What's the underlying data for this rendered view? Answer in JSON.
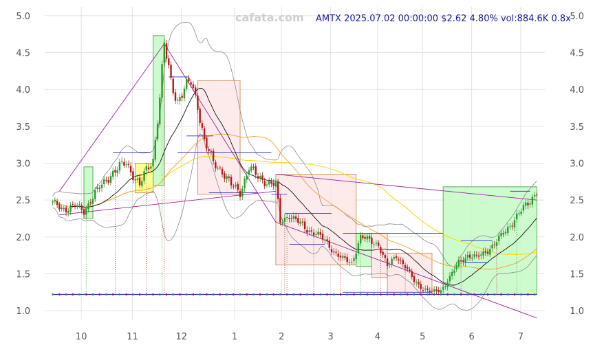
{
  "chart_data": {
    "type": "candlestick",
    "ticker": "AMTX",
    "header": "AMTX 2025.07.02 00:00:00 $2.62 4.80% vol:884.6K 0.8x",
    "watermark": "cafata.com",
    "x_tick_labels": [
      "10",
      "11",
      "12",
      "1",
      "2",
      "3",
      "4",
      "5",
      "6",
      "7"
    ],
    "y_ticks": [
      1.0,
      1.5,
      2.0,
      2.5,
      3.0,
      3.5,
      4.0,
      4.5,
      5.0
    ],
    "y_tick_labels": [
      "1.0",
      "1.5",
      "2.0",
      "2.5",
      "3.0",
      "3.5",
      "4.0",
      "4.5",
      "5.0"
    ],
    "ylim": [
      0.88,
      5.12
    ],
    "grid": true,
    "price_anchors": [
      [
        0,
        2.45
      ],
      [
        5,
        2.38
      ],
      [
        10,
        2.42
      ],
      [
        14,
        2.35
      ],
      [
        18,
        2.55
      ],
      [
        22,
        2.7
      ],
      [
        26,
        2.85
      ],
      [
        30,
        2.95
      ],
      [
        33,
        3.0
      ],
      [
        36,
        2.85
      ],
      [
        39,
        2.7
      ],
      [
        42,
        2.9
      ],
      [
        45,
        3.05
      ],
      [
        48,
        3.9
      ],
      [
        50,
        4.6
      ],
      [
        53,
        4.1
      ],
      [
        56,
        3.85
      ],
      [
        59,
        4.0
      ],
      [
        62,
        4.1
      ],
      [
        65,
        3.8
      ],
      [
        68,
        3.3
      ],
      [
        72,
        3.0
      ],
      [
        76,
        2.9
      ],
      [
        80,
        2.7
      ],
      [
        84,
        2.6
      ],
      [
        88,
        2.95
      ],
      [
        92,
        2.8
      ],
      [
        96,
        2.75
      ],
      [
        100,
        2.7
      ],
      [
        102,
        2.2
      ],
      [
        106,
        2.3
      ],
      [
        110,
        2.2
      ],
      [
        114,
        2.1
      ],
      [
        118,
        2.05
      ],
      [
        122,
        1.95
      ],
      [
        126,
        1.8
      ],
      [
        130,
        1.7
      ],
      [
        134,
        1.65
      ],
      [
        138,
        2.0
      ],
      [
        142,
        1.95
      ],
      [
        146,
        1.9
      ],
      [
        150,
        1.6
      ],
      [
        154,
        1.75
      ],
      [
        158,
        1.6
      ],
      [
        162,
        1.4
      ],
      [
        166,
        1.3
      ],
      [
        170,
        1.25
      ],
      [
        174,
        1.28
      ],
      [
        178,
        1.45
      ],
      [
        182,
        1.65
      ],
      [
        186,
        1.75
      ],
      [
        190,
        1.72
      ],
      [
        194,
        1.8
      ],
      [
        198,
        1.9
      ],
      [
        202,
        2.05
      ],
      [
        206,
        2.2
      ],
      [
        210,
        2.35
      ],
      [
        214,
        2.5
      ],
      [
        217,
        2.62
      ]
    ],
    "bars_total": 218,
    "colors": {
      "up": "#2a9a2a",
      "down": "#b01818",
      "ma_short": "#111111",
      "ma_mid": "#f2a93b",
      "ma_long": "#ffd400",
      "bollinger": "#8a8a8a",
      "trend_line": "#9c1fa0",
      "level_line": "#2d2dcc",
      "zone_green_fill": "#c9fbc9",
      "zone_green_edge": "#44aa44",
      "zone_red_fill": "#fde9e9",
      "zone_red_edge": "#d08a4a",
      "zone_yellow_fill": "#ffff88",
      "baseline": "#2a2acc"
    },
    "zones": [
      {
        "kind": "green",
        "x0": 14,
        "x1": 18,
        "y0": 2.25,
        "y1": 2.95
      },
      {
        "kind": "yellow",
        "x0": 37,
        "x1": 45,
        "y0": 2.6,
        "y1": 3.0
      },
      {
        "kind": "green",
        "x0": 45,
        "x1": 50,
        "y0": 2.7,
        "y1": 4.73
      },
      {
        "kind": "red",
        "x0": 65,
        "x1": 84,
        "y0": 2.58,
        "y1": 4.12
      },
      {
        "kind": "red",
        "x0": 100,
        "x1": 136,
        "y0": 1.62,
        "y1": 2.85
      },
      {
        "kind": "green",
        "x0": 136,
        "x1": 143,
        "y0": 1.6,
        "y1": 2.05
      },
      {
        "kind": "red",
        "x0": 143,
        "x1": 150,
        "y0": 1.45,
        "y1": 2.05
      },
      {
        "kind": "red",
        "x0": 150,
        "x1": 170,
        "y0": 1.22,
        "y1": 1.78
      },
      {
        "kind": "green",
        "x0": 175,
        "x1": 217,
        "y0": 1.22,
        "y1": 2.68
      }
    ],
    "level_lines": [
      {
        "x0": 27,
        "x1": 44,
        "y": 3.15
      },
      {
        "x0": 52,
        "x1": 61,
        "y": 4.17
      },
      {
        "x0": 56,
        "x1": 98,
        "y": 3.15
      },
      {
        "x0": 60,
        "x1": 72,
        "y": 3.37
      },
      {
        "x0": 70,
        "x1": 92,
        "y": 2.6
      },
      {
        "x0": 98,
        "x1": 105,
        "y": 2.58
      },
      {
        "x0": 104,
        "x1": 125,
        "y": 2.32
      },
      {
        "x0": 106,
        "x1": 122,
        "y": 1.9
      },
      {
        "x0": 130,
        "x1": 175,
        "y": 2.05
      },
      {
        "x0": 130,
        "x1": 170,
        "y": 1.25
      },
      {
        "x0": 183,
        "x1": 197,
        "y": 1.95
      },
      {
        "x0": 185,
        "x1": 195,
        "y": 1.65
      },
      {
        "x0": 205,
        "x1": 214,
        "y": 2.62
      }
    ],
    "trend_lines": [
      {
        "x0": 3,
        "y0": 2.62,
        "x1": 50,
        "y1": 4.62
      },
      {
        "x0": 50,
        "y0": 4.62,
        "x1": 100,
        "y1": 2.2
      },
      {
        "x0": 3,
        "y0": 2.3,
        "x1": 100,
        "y1": 2.62
      },
      {
        "x0": 100,
        "y0": 2.85,
        "x1": 217,
        "y1": 2.5
      },
      {
        "x0": 100,
        "y0": 2.2,
        "x1": 217,
        "y1": 0.9
      }
    ],
    "baseline_y": 1.22,
    "marker_lines": [
      15,
      28,
      42,
      49,
      50,
      104,
      105,
      117,
      129,
      138,
      147,
      158,
      174,
      183,
      199,
      208
    ]
  }
}
